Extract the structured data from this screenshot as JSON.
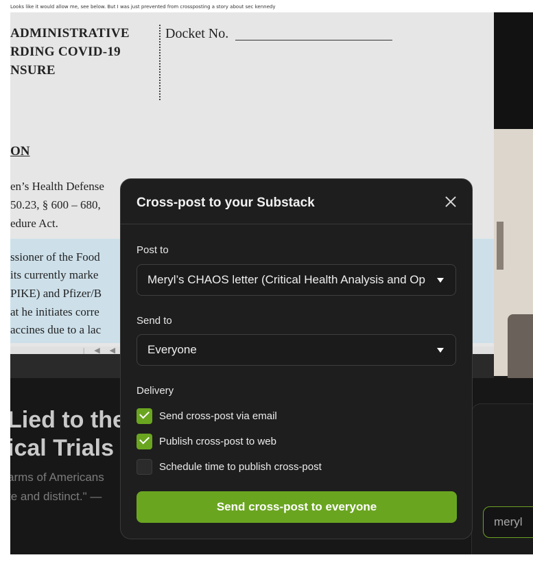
{
  "caption": "Looks like it would allow me, see below.  But I was just prevented from crossposting a story about sec kennedy",
  "document": {
    "heading_lines": [
      "ADMINISTRATIVE",
      "RDING COVID-19",
      "NSURE"
    ],
    "docket_label": "Docket No.",
    "section_heading": "ON",
    "body_lines": [
      "en’s Health Defense",
      "50.23, § 600 – 680,",
      "edure Act.",
      "ssioner of the Food",
      "its currently marke",
      "PIKE) and Pfizer/B",
      "at he initiates corre",
      "accines due to a lac"
    ]
  },
  "background_post": {
    "title_lines": [
      "Lied to the",
      "ical Trials"
    ],
    "text_lines": [
      "arms of Americans",
      "te and distinct.\" —"
    ],
    "side_input_text": "meryl"
  },
  "modal": {
    "title": "Cross-post to your Substack",
    "post_to_label": "Post to",
    "post_to_value": "Meryl’s CHAOS letter (Critical Health Analysis and Op",
    "send_to_label": "Send to",
    "send_to_value": "Everyone",
    "delivery_label": "Delivery",
    "options": [
      {
        "label": "Send cross-post via email",
        "checked": true
      },
      {
        "label": "Publish cross-post to web",
        "checked": true
      },
      {
        "label": "Schedule time to publish cross-post",
        "checked": false
      }
    ],
    "submit_label": "Send cross-post to everyone"
  },
  "colors": {
    "accent": "#6aa520",
    "modal_bg": "#1e1e1e",
    "page_bg": "#ffffff"
  },
  "icons": {
    "close": "close-icon",
    "dropdown": "chevron-down-icon",
    "check": "checkmark-icon"
  }
}
